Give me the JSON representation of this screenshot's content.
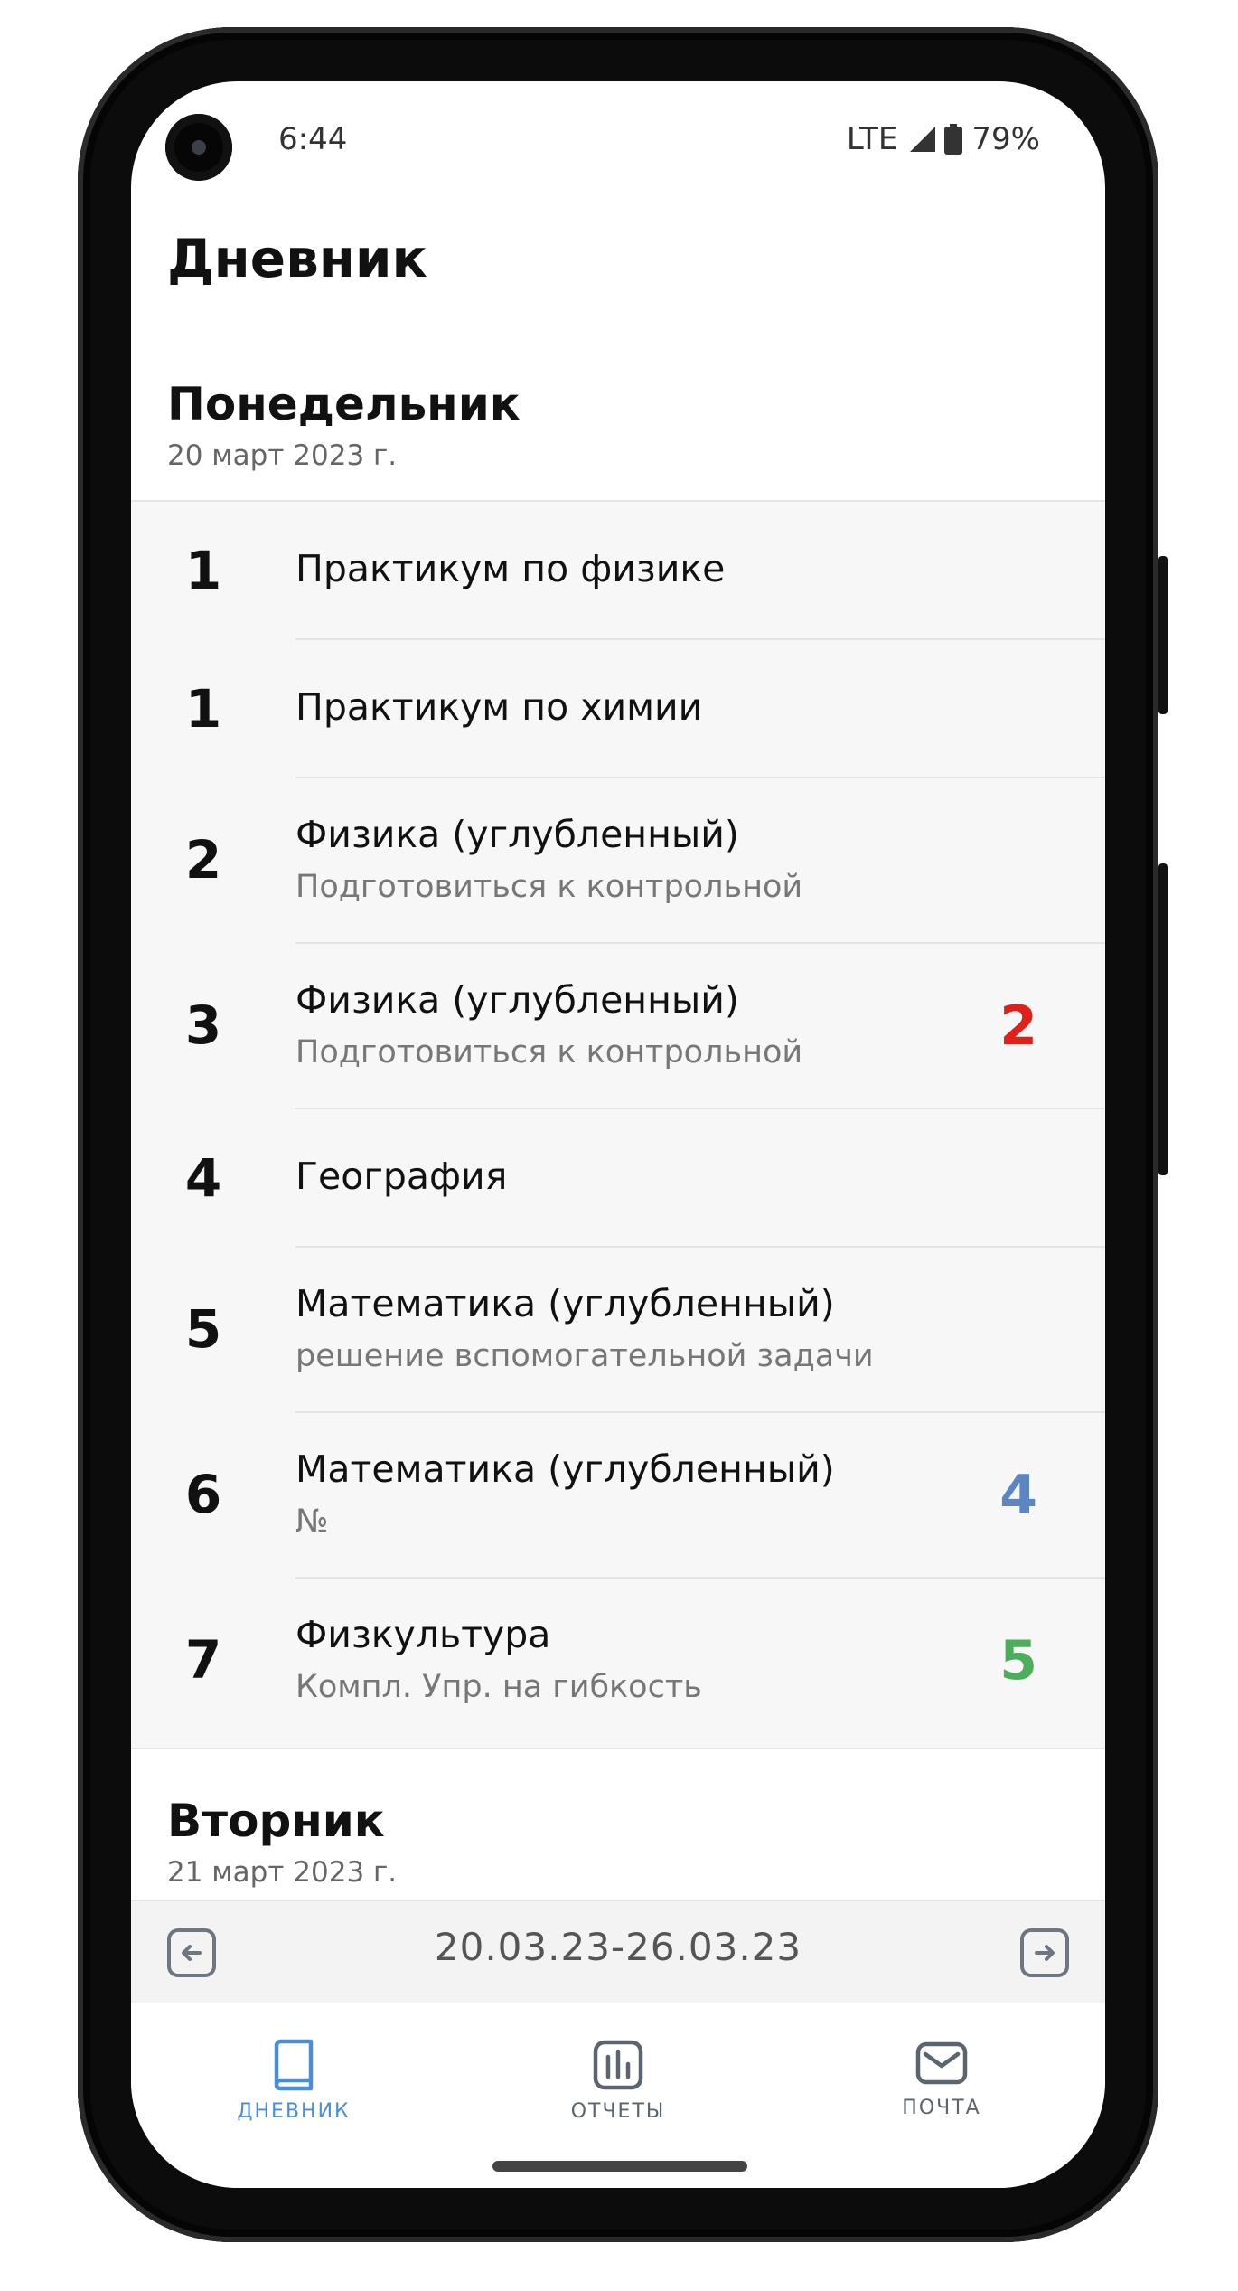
{
  "status_bar": {
    "time": "6:44",
    "network": "LTE",
    "battery": "79%"
  },
  "app": {
    "title": "Дневник"
  },
  "days": [
    {
      "name": "Понедельник",
      "date": "20 март 2023 г.",
      "lessons": [
        {
          "number": "1",
          "subject": "Практикум по физике",
          "homework": "",
          "grade": ""
        },
        {
          "number": "1",
          "subject": "Практикум по химии",
          "homework": "",
          "grade": ""
        },
        {
          "number": "2",
          "subject": "Физика (углубленный)",
          "homework": "Подготовиться к контрольной",
          "grade": ""
        },
        {
          "number": "3",
          "subject": "Физика (углубленный)",
          "homework": "Подготовиться к контрольной",
          "grade": "2"
        },
        {
          "number": "4",
          "subject": "География",
          "homework": "",
          "grade": ""
        },
        {
          "number": "5",
          "subject": "Математика (углубленный)",
          "homework": "решение вспомогательной задачи",
          "grade": ""
        },
        {
          "number": "6",
          "subject": "Математика (углубленный)",
          "homework": "№",
          "grade": "4"
        },
        {
          "number": "7",
          "subject": "Физкультура",
          "homework": "Компл. Упр. на гибкость",
          "grade": "5"
        }
      ]
    },
    {
      "name": "Вторник",
      "date": "21 март 2023 г."
    }
  ],
  "week_nav": {
    "range": "20.03.23-26.03.23",
    "prev_icon": "arrow-left-icon",
    "next_icon": "arrow-right-icon"
  },
  "tabs": [
    {
      "label": "ДНЕВНИК",
      "icon": "book-icon",
      "active": true
    },
    {
      "label": "ОТЧЕТЫ",
      "icon": "chart-icon",
      "active": false
    },
    {
      "label": "ПОЧТА",
      "icon": "mail-icon",
      "active": false
    }
  ],
  "colors": {
    "grade_2": "#e0211b",
    "grade_4": "#5b86c2",
    "grade_5": "#4cae5a",
    "active_tab": "#4a8fd6",
    "inactive_tab": "#5a6570"
  }
}
